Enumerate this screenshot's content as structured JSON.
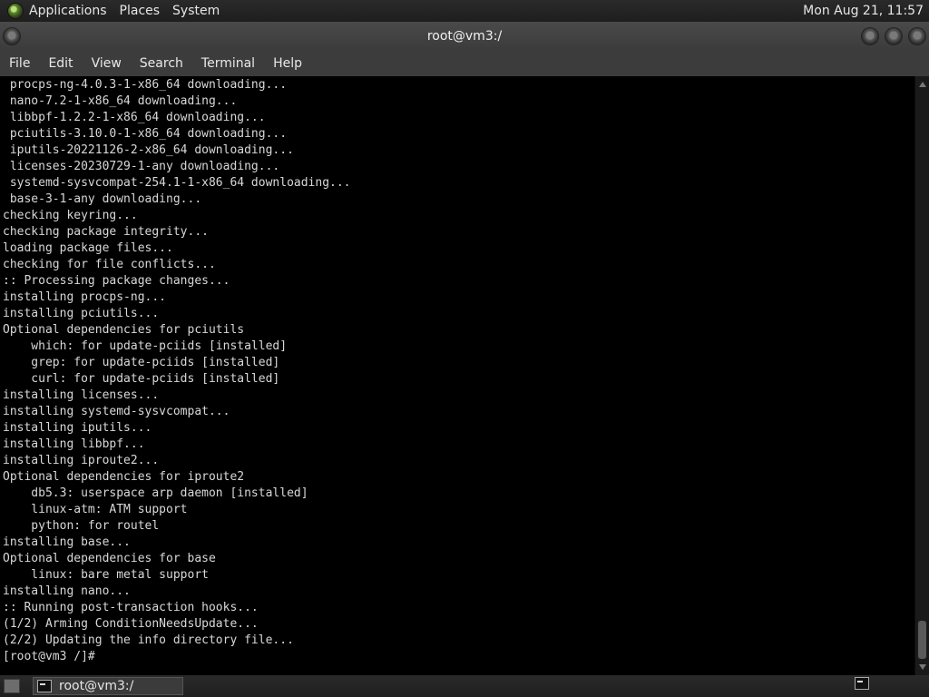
{
  "top_panel": {
    "menus": [
      "Applications",
      "Places",
      "System"
    ],
    "clock": "Mon Aug 21, 11:57"
  },
  "window": {
    "title": "root@vm3:/",
    "menu": [
      "File",
      "Edit",
      "View",
      "Search",
      "Terminal",
      "Help"
    ]
  },
  "terminal": {
    "lines": [
      " procps-ng-4.0.3-1-x86_64 downloading...",
      " nano-7.2-1-x86_64 downloading...",
      " libbpf-1.2.2-1-x86_64 downloading...",
      " pciutils-3.10.0-1-x86_64 downloading...",
      " iputils-20221126-2-x86_64 downloading...",
      " licenses-20230729-1-any downloading...",
      " systemd-sysvcompat-254.1-1-x86_64 downloading...",
      " base-3-1-any downloading...",
      "checking keyring...",
      "checking package integrity...",
      "loading package files...",
      "checking for file conflicts...",
      ":: Processing package changes...",
      "installing procps-ng...",
      "installing pciutils...",
      "Optional dependencies for pciutils",
      "    which: for update-pciids [installed]",
      "    grep: for update-pciids [installed]",
      "    curl: for update-pciids [installed]",
      "installing licenses...",
      "installing systemd-sysvcompat...",
      "installing iputils...",
      "installing libbpf...",
      "installing iproute2...",
      "Optional dependencies for iproute2",
      "    db5.3: userspace arp daemon [installed]",
      "    linux-atm: ATM support",
      "    python: for routel",
      "installing base...",
      "Optional dependencies for base",
      "    linux: bare metal support",
      "installing nano...",
      ":: Running post-transaction hooks...",
      "(1/2) Arming ConditionNeedsUpdate...",
      "(2/2) Updating the info directory file...",
      "[root@vm3 /]#"
    ]
  },
  "taskbar": {
    "window_label": "root@vm3:/"
  }
}
